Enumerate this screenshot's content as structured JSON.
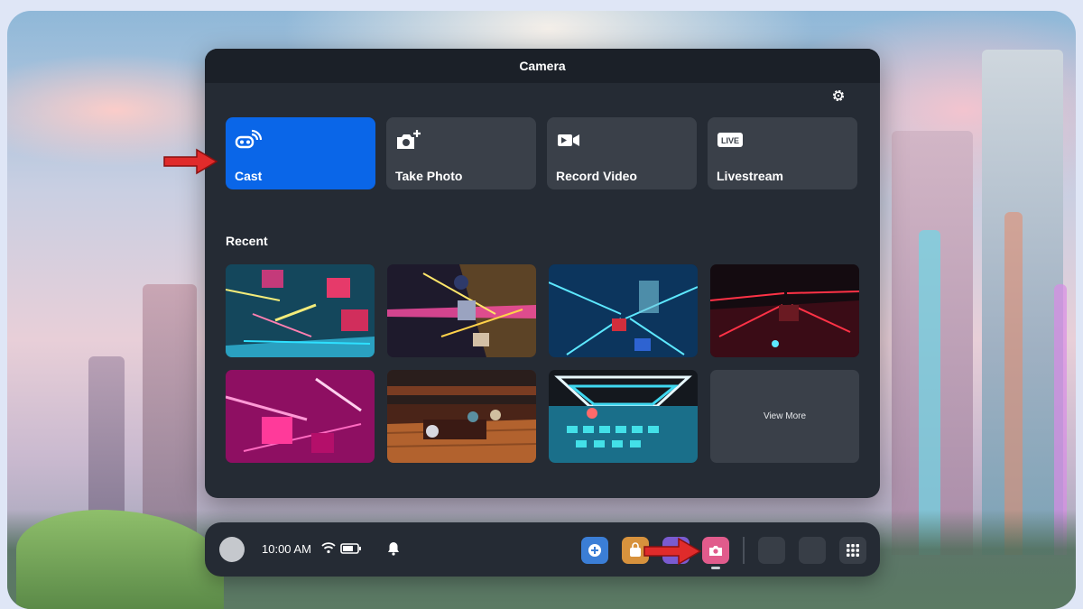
{
  "panel": {
    "title": "Camera",
    "actions": [
      {
        "label": "Cast",
        "icon": "cast-icon",
        "active": true
      },
      {
        "label": "Take Photo",
        "icon": "camera-add-icon",
        "active": false
      },
      {
        "label": "Record Video",
        "icon": "video-camera-icon",
        "active": false
      },
      {
        "label": "Livestream",
        "icon": "live-icon",
        "active": false
      }
    ],
    "live_badge": "LIVE",
    "recent_label": "Recent",
    "view_more": "View More"
  },
  "dock": {
    "time": "10:00 AM",
    "icons": [
      "wifi-icon",
      "battery-icon",
      "bell-icon"
    ],
    "apps": [
      "add-app-icon",
      "store-app-icon",
      "social-app-icon",
      "camera-app-icon"
    ],
    "apps_grid_icon": "grid-icon"
  },
  "colors": {
    "accent": "#0a66e8",
    "panel_bg": "#252b34",
    "tile_bg": "#3a4049",
    "arrow": "#e02b2b"
  }
}
